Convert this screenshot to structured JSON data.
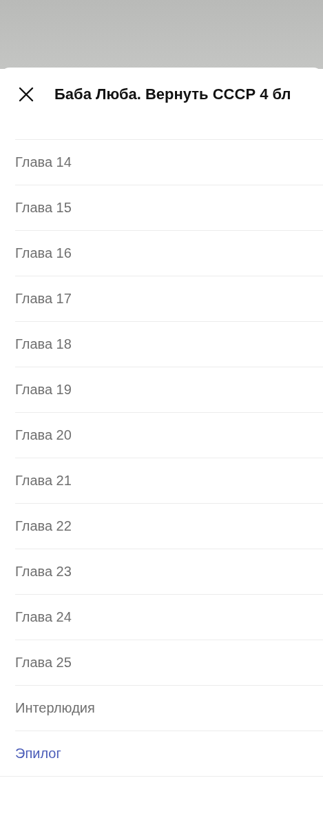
{
  "sheet": {
    "title": "Баба Люба. Вернуть СССР 4 бл"
  },
  "chapters": [
    {
      "label": "Глава 14",
      "selected": false
    },
    {
      "label": "Глава 15",
      "selected": false
    },
    {
      "label": "Глава 16",
      "selected": false
    },
    {
      "label": "Глава 17",
      "selected": false
    },
    {
      "label": "Глава 18",
      "selected": false
    },
    {
      "label": "Глава 19",
      "selected": false
    },
    {
      "label": "Глава 20",
      "selected": false
    },
    {
      "label": "Глава 21",
      "selected": false
    },
    {
      "label": "Глава 22",
      "selected": false
    },
    {
      "label": "Глава 23",
      "selected": false
    },
    {
      "label": "Глава 24",
      "selected": false
    },
    {
      "label": "Глава 25",
      "selected": false
    },
    {
      "label": "Интерлюдия",
      "selected": false
    },
    {
      "label": "Эпилог",
      "selected": true
    }
  ]
}
